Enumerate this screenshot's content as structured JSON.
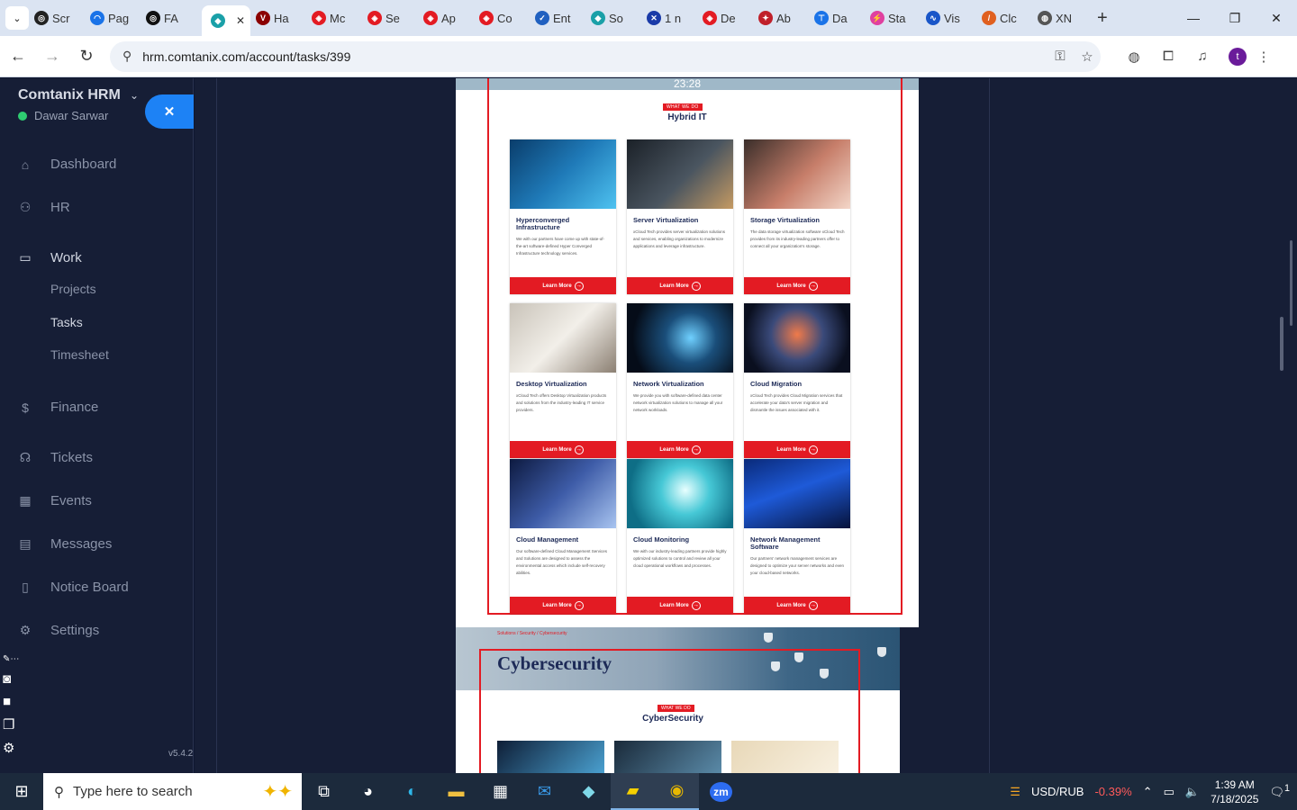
{
  "browser": {
    "tabs": [
      {
        "label": "Scr",
        "color": "#222222",
        "glyph": "◎"
      },
      {
        "label": "Pag",
        "color": "#1a73e8",
        "glyph": "◠"
      },
      {
        "label": "FA",
        "color": "#111111",
        "glyph": "◎"
      },
      {
        "label": "",
        "color": "#1aa0a8",
        "glyph": "◆",
        "active": true
      },
      {
        "label": "Ha",
        "color": "#8b0000",
        "glyph": "V"
      },
      {
        "label": "Mc",
        "color": "#e31b23",
        "glyph": "◈"
      },
      {
        "label": "Se",
        "color": "#e31b23",
        "glyph": "◈"
      },
      {
        "label": "Ap",
        "color": "#e31b23",
        "glyph": "◈"
      },
      {
        "label": "Co",
        "color": "#e31b23",
        "glyph": "◈"
      },
      {
        "label": "Ent",
        "color": "#2060c0",
        "glyph": "✓"
      },
      {
        "label": "So",
        "color": "#1aa0a8",
        "glyph": "◆"
      },
      {
        "label": "1 n",
        "color": "#1a3aa8",
        "glyph": "✕"
      },
      {
        "label": "De",
        "color": "#e31b23",
        "glyph": "◈"
      },
      {
        "label": "Ab",
        "color": "#c0202a",
        "glyph": "✦"
      },
      {
        "label": "Da",
        "color": "#1a73e8",
        "glyph": "⊤"
      },
      {
        "label": "Sta",
        "color": "#e040a0",
        "glyph": "⚡"
      },
      {
        "label": "Vis",
        "color": "#1a56c8",
        "glyph": "∿"
      },
      {
        "label": "Clc",
        "color": "#e06020",
        "glyph": "/"
      },
      {
        "label": "XN",
        "color": "#555555",
        "glyph": "◍"
      }
    ],
    "tab_close": "✕",
    "new_tab": "+",
    "url": "hrm.comtanix.com/account/tasks/399",
    "window_controls": {
      "minimize": "—",
      "maximize": "❐",
      "close": "✕"
    }
  },
  "sidebar": {
    "brand": "Comtanix HRM",
    "user": "Dawar Sarwar",
    "collapse_glyph": "✕",
    "items": [
      {
        "label": "Dashboard",
        "icon": "⌂",
        "name": "dashboard"
      },
      {
        "label": "HR",
        "icon": "⚇",
        "name": "hr"
      },
      {
        "label": "Work",
        "icon": "▭",
        "name": "work",
        "active": true
      },
      {
        "label": "Finance",
        "icon": "$",
        "name": "finance"
      },
      {
        "label": "Tickets",
        "icon": "☊",
        "name": "tickets"
      },
      {
        "label": "Events",
        "icon": "▦",
        "name": "events"
      },
      {
        "label": "Messages",
        "icon": "▤",
        "name": "messages"
      },
      {
        "label": "Notice Board",
        "icon": "▯",
        "name": "notice-board"
      },
      {
        "label": "Settings",
        "icon": "⚙",
        "name": "settings"
      }
    ],
    "sub_items": [
      {
        "label": "Projects",
        "name": "projects"
      },
      {
        "label": "Tasks",
        "name": "tasks",
        "active": true
      },
      {
        "label": "Timesheet",
        "name": "timesheet"
      }
    ],
    "version": "v5.4.2"
  },
  "attachment": {
    "top_text": "23:28",
    "badge": "WHAT WE DO",
    "title": "Hybrid IT",
    "button_label": "Learn More",
    "cards": [
      {
        "title": "Hyperconverged Infrastructure",
        "desc": "We with our partners have come up with state-of-the-art software-defined Hyper Converged Infrastructure technology services.",
        "img": "linear-gradient(135deg,#0a3d6b 0%,#1f7ab8 50%,#4ec2f0 100%)"
      },
      {
        "title": "Server Virtualization",
        "desc": "xCloud Tech provides server virtualization solutions and services, enabling organizations to modernize applications and leverage infrastructure.",
        "img": "linear-gradient(135deg,#1b2128 0%,#4a5560 55%,#c59a63 100%)"
      },
      {
        "title": "Storage Virtualization",
        "desc": "The data storage virtualization software xCloud Tech provides from its industry-leading partners offer to connect all your organization's storage.",
        "img": "linear-gradient(135deg,#3a2e2a 0%,#c77e6a 55%,#f3d6c8 100%)"
      },
      {
        "title": "Desktop Virtualization",
        "desc": "xCloud Tech offers Desktop Virtualization products and solutions from the industry-leading IT service providers.",
        "img": "linear-gradient(135deg,#c9c3b9 0%,#f2efe9 50%,#8b7f72 100%)"
      },
      {
        "title": "Network Virtualization",
        "desc": "We provide you with software-defined data center network virtualization solutions to manage all your network workloads.",
        "img": "radial-gradient(circle at 60% 50%,#6fd0ff 0%,#1a4e7a 35%,#050c18 80%)"
      },
      {
        "title": "Cloud Migration",
        "desc": "xCloud Tech provides Cloud Migration services that accelerate your data's server migration and dismantle the issues associated with it.",
        "img": "radial-gradient(circle at 50% 45%,#f07a4a 0%,#3a4a7a 40%,#0a0f1f 80%)"
      },
      {
        "title": "Cloud Management",
        "desc": "Our software-defined Cloud Management Services and Solutions are designed to assess the environmental access which include self-recovery abilities.",
        "img": "linear-gradient(135deg,#0d1a40 0%,#3e5ca8 50%,#a8c4f0 100%)"
      },
      {
        "title": "Cloud Monitoring",
        "desc": "We with our industry-leading partners provide highly optimized solutions to control and review all your cloud operational workflows and processes.",
        "img": "radial-gradient(circle at 55% 45%,#e8ffff 0%,#46c8d6 35%,#0e6e86 80%)"
      },
      {
        "title": "Network Management Software",
        "desc": "Our partners' network management services are designed to optimize your server networks and even your cloud-based networks.",
        "img": "linear-gradient(160deg,#0a2a7a 0%,#1e5ad8 45%,#06123a 100%)"
      }
    ],
    "next_breadcrumb": "Solutions  /  Security  /  Cybersecurity",
    "next_heading": "Cybersecurity",
    "next_badge": "WHAT WE DO",
    "next_title": "CyberSecurity",
    "next_thumbs": [
      "linear-gradient(135deg,#0e1e36 0%,#4aa0d0 100%)",
      "linear-gradient(135deg,#1a2a3a 0%,#5a8aa8 100%)",
      "linear-gradient(135deg,#e8d8b8 0%,#f8f0e0 100%)"
    ]
  },
  "taskbar": {
    "search_placeholder": "Type here to search",
    "apps": [
      {
        "name": "task-view",
        "glyph": "⧉"
      },
      {
        "name": "copilot",
        "glyph": "◕"
      },
      {
        "name": "edge",
        "glyph": "◐"
      },
      {
        "name": "file-explorer",
        "glyph": "▬"
      },
      {
        "name": "store",
        "glyph": "▦"
      },
      {
        "name": "mail",
        "glyph": "✉"
      },
      {
        "name": "app-diamond",
        "glyph": "◆"
      },
      {
        "name": "sticky-notes",
        "glyph": "▰",
        "active": true
      },
      {
        "name": "chrome",
        "glyph": "◉",
        "active": true
      },
      {
        "name": "zoom",
        "glyph": "zm"
      }
    ],
    "ticker": "USD/RUB",
    "ticker_change": "-0.39%",
    "time": "1:39 AM",
    "date": "7/18/2025",
    "notifications": "1"
  }
}
